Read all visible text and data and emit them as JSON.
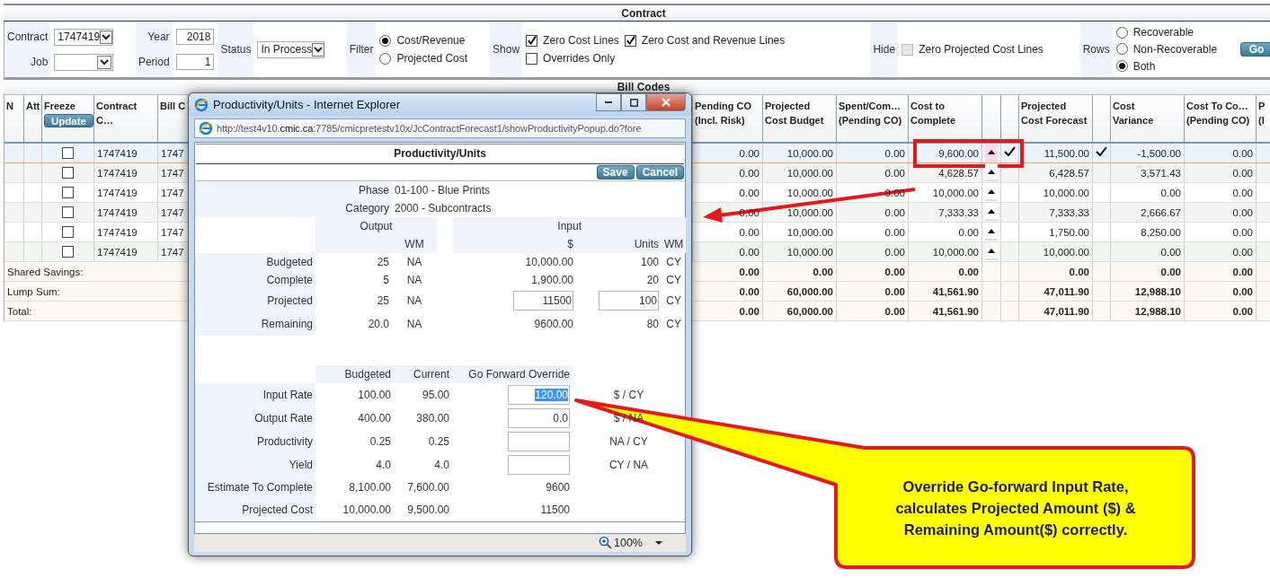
{
  "contract_band": {
    "title": "Contract"
  },
  "filters": {
    "contract": {
      "label": "Contract",
      "value": "1747419"
    },
    "job": {
      "label": "Job"
    },
    "year": {
      "label": "Year",
      "value": "2018"
    },
    "period": {
      "label": "Period",
      "value": "1"
    },
    "status": {
      "label": "Status",
      "value": "In Process"
    },
    "filter": {
      "label": "Filter",
      "options": [
        {
          "label": "Cost/Revenue",
          "selected": true
        },
        {
          "label": "Projected Cost",
          "selected": false
        }
      ]
    },
    "show": {
      "label": "Show",
      "options": [
        {
          "label": "Zero Cost Lines",
          "checked": true
        },
        {
          "label": "Zero Cost and Revenue Lines",
          "checked": true
        },
        {
          "label": "Overrides Only",
          "checked": false
        }
      ]
    },
    "hide": {
      "label": "Hide",
      "options": [
        {
          "label": "Zero Projected Cost Lines",
          "checked": false,
          "disabled": true
        }
      ]
    },
    "rows": {
      "label": "Rows",
      "options": [
        {
          "label": "Recoverable",
          "selected": false
        },
        {
          "label": "Non-Recoverable",
          "selected": false
        },
        {
          "label": "Both",
          "selected": true
        }
      ]
    },
    "go_button": "Go"
  },
  "bill_codes": {
    "title": "Bill Codes",
    "update_button": "Update",
    "left_columns": [
      {
        "label": "N",
        "kind": "empty"
      },
      {
        "label": "Att",
        "kind": "empty"
      },
      {
        "label": "Freeze",
        "kind": "freeze"
      },
      {
        "label": "Contract C…",
        "kind": "text"
      },
      {
        "label": "Bill C",
        "kind": "text"
      }
    ],
    "right_columns": [
      {
        "label": "Pending CO\n(Incl. Risk)",
        "kind": "text"
      },
      {
        "label": "Projected\nCost Budget",
        "kind": "text"
      },
      {
        "label": "Spent/Com…\n(Pending CO)",
        "kind": "text"
      },
      {
        "label": "Cost to\nComplete",
        "kind": "text"
      },
      {
        "kind": "arrow"
      },
      {
        "kind": "check"
      },
      {
        "label": "Projected\nCost Forecast",
        "kind": "text"
      },
      {
        "kind": "check"
      },
      {
        "label": "Cost\nVariance",
        "kind": "text"
      },
      {
        "label": "Cost To Co…\n(Pending CO)",
        "kind": "text"
      },
      {
        "label": "P\n(I",
        "kind": "text"
      }
    ],
    "rows": [
      {
        "selected": true,
        "freeze": false,
        "override": true,
        "arrow_highlighted": true,
        "cells": [
          "1747419",
          "1747",
          "0.00",
          "10,000.00",
          "0.00",
          "9,600.00",
          "11,500.00",
          "-1,500.00",
          "0.00"
        ]
      },
      {
        "selected": false,
        "freeze": false,
        "override": false,
        "arrow_highlighted": false,
        "cells": [
          "1747419",
          "1747",
          "0.00",
          "10,000.00",
          "0.00",
          "4,628.57",
          "6,428.57",
          "3,571.43",
          "0.00"
        ]
      },
      {
        "selected": false,
        "freeze": false,
        "override": false,
        "arrow_highlighted": false,
        "cells": [
          "1747419",
          "1747",
          "0.00",
          "10,000.00",
          "0.00",
          "10,000.00",
          "10,000.00",
          "0.00",
          "0.00"
        ]
      },
      {
        "selected": false,
        "freeze": false,
        "override": false,
        "arrow_highlighted": false,
        "cells": [
          "1747419",
          "1747",
          "0.00",
          "10,000.00",
          "0.00",
          "7,333.33",
          "7,333.33",
          "2,666.67",
          "0.00"
        ]
      },
      {
        "selected": false,
        "freeze": false,
        "override": false,
        "arrow_highlighted": false,
        "cells": [
          "1747419",
          "1747",
          "0.00",
          "10,000.00",
          "0.00",
          "0.00",
          "1,750.00",
          "8,250.00",
          "0.00"
        ]
      },
      {
        "selected": false,
        "freeze": false,
        "override": false,
        "arrow_highlighted": false,
        "cells": [
          "1747419",
          "1747",
          "0.00",
          "10,000.00",
          "0.00",
          "10,000.00",
          "10,000.00",
          "0.00",
          "0.00"
        ]
      }
    ],
    "summary_rows": [
      {
        "label": "Shared Savings:",
        "values": [
          "0.00",
          "0.00",
          "0.00",
          "0.00",
          "0.00",
          "0.00",
          "0.00"
        ]
      },
      {
        "label": "Lump Sum:",
        "values": [
          "0.00",
          "60,000.00",
          "0.00",
          "41,561.90",
          "47,011.90",
          "12,988.10",
          "0.00"
        ]
      },
      {
        "label": "Total:",
        "values": [
          "0.00",
          "60,000.00",
          "0.00",
          "41,561.90",
          "47,011.90",
          "12,988.10",
          "0.00"
        ]
      }
    ]
  },
  "popup": {
    "title": "Productivity/Units - Internet Explorer",
    "url": "http://test4v10.**cmic.ca**:7785/cmicpretestv10x/JcContractForecast1/showProductivityPopup.do?fore",
    "heading": "Productivity/Units",
    "buttons": [
      "Save",
      "Cancel"
    ],
    "info": [
      {
        "label": "Phase",
        "value": "01-100 - Blue Prints"
      },
      {
        "label": "Category",
        "value": "2000 - Subcontracts"
      }
    ],
    "quantities": {
      "output_header": "Output",
      "input_header": "Input",
      "output_wm": "WM",
      "amount": "$",
      "units": "Units",
      "input_wm": "WM",
      "rows": [
        {
          "label": "Budgeted",
          "kind": "text",
          "output": "25",
          "output_wm": "NA",
          "amount": "10,000.00",
          "units": "100",
          "input_wm": "CY"
        },
        {
          "label": "Complete",
          "kind": "text",
          "output": "5",
          "output_wm": "NA",
          "amount": "1,900.00",
          "units": "20",
          "input_wm": "CY"
        },
        {
          "label": "Projected",
          "kind": "input",
          "output": "25",
          "output_wm": "NA",
          "amount": "11500",
          "units": "100",
          "input_wm": "CY"
        },
        {
          "label": "Remaining",
          "kind": "text",
          "output": "20.0",
          "output_wm": "NA",
          "amount": "9600.00",
          "units": "80",
          "input_wm": "CY"
        }
      ]
    },
    "rates": {
      "columns": [
        "Budgeted",
        "Current",
        "Go Forward Override"
      ],
      "rows": [
        {
          "label": "Input Rate",
          "budgeted": "100.00",
          "current": "95.00",
          "kind": "input",
          "override": "120.00",
          "highlighted": true,
          "unit": "$ / CY"
        },
        {
          "label": "Output Rate",
          "budgeted": "400.00",
          "current": "380.00",
          "kind": "input",
          "override": "0.0",
          "highlighted": false,
          "unit": "$ / NA"
        },
        {
          "label": "Productivity",
          "budgeted": "0.25",
          "current": "0.25",
          "kind": "input",
          "unit": "NA / CY"
        },
        {
          "label": "Yield",
          "budgeted": "4.0",
          "current": "4.0",
          "kind": "input",
          "unit": "CY / NA"
        },
        {
          "label": "Estimate To Complete",
          "budgeted": "8,100.00",
          "current": "7,600.00",
          "kind": "text",
          "override": "9600"
        },
        {
          "label": "Projected Cost",
          "budgeted": "10,000.00",
          "current": "9,500.00",
          "kind": "text",
          "override": "11500"
        }
      ]
    },
    "zoom": "100%"
  },
  "callout": {
    "text": "Override Go-forward Input Rate,\ncalculates Projected Amount ($) &\nRemaining Amount($) correctly."
  }
}
